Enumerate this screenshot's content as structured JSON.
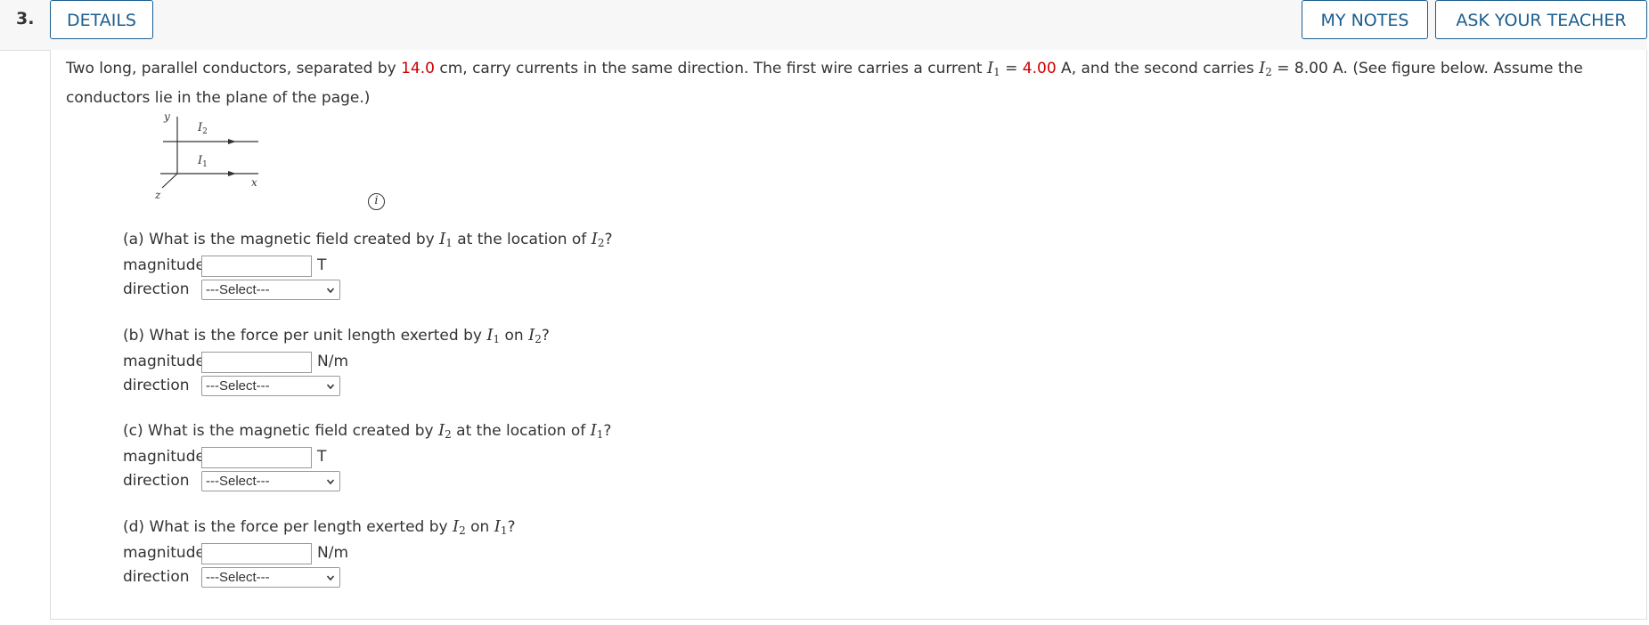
{
  "question": {
    "number": "3.",
    "details_label": "DETAILS",
    "my_notes_label": "MY NOTES",
    "ask_teacher_label": "ASK YOUR TEACHER"
  },
  "prompt": {
    "t1": "Two long, parallel conductors, separated by ",
    "separation": "14.0",
    "t2": " cm, carry currents in the same direction. The first wire carries a current ",
    "I": "I",
    "sub1": "1",
    "t3": " = ",
    "current1": "4.00",
    "t4": " A, and the second carries ",
    "sub2": "2",
    "t5": " = 8.00 A. (See figure below. Assume the conductors lie in the plane of the page.)"
  },
  "figure": {
    "y_label": "y",
    "x_label": "x",
    "z_label": "z",
    "I": "I",
    "sub1": "1",
    "sub2": "2"
  },
  "info_icon": "i",
  "parts": [
    {
      "pre": "(a) What is the magnetic field created by ",
      "v1sub": "1",
      "mid": " at the location of ",
      "v2sub": "2",
      "post": "?",
      "magnitude_label": "magnitude",
      "magnitude_value": "",
      "unit": "T",
      "direction_label": "direction",
      "direction_selected": "---Select---"
    },
    {
      "pre": "(b) What is the force per unit length exerted by ",
      "v1sub": "1",
      "mid": " on ",
      "v2sub": "2",
      "post": "?",
      "magnitude_label": "magnitude",
      "magnitude_value": "",
      "unit": "N/m",
      "direction_label": "direction",
      "direction_selected": "---Select---"
    },
    {
      "pre": "(c) What is the magnetic field created by ",
      "v1sub": "2",
      "mid": " at the location of ",
      "v2sub": "1",
      "post": "?",
      "magnitude_label": "magnitude",
      "magnitude_value": "",
      "unit": "T",
      "direction_label": "direction",
      "direction_selected": "---Select---"
    },
    {
      "pre": "(d) What is the force per length exerted by ",
      "v1sub": "2",
      "mid": " on ",
      "v2sub": "1",
      "post": "?",
      "magnitude_label": "magnitude",
      "magnitude_value": "",
      "unit": "N/m",
      "direction_label": "direction",
      "direction_selected": "---Select---"
    }
  ]
}
